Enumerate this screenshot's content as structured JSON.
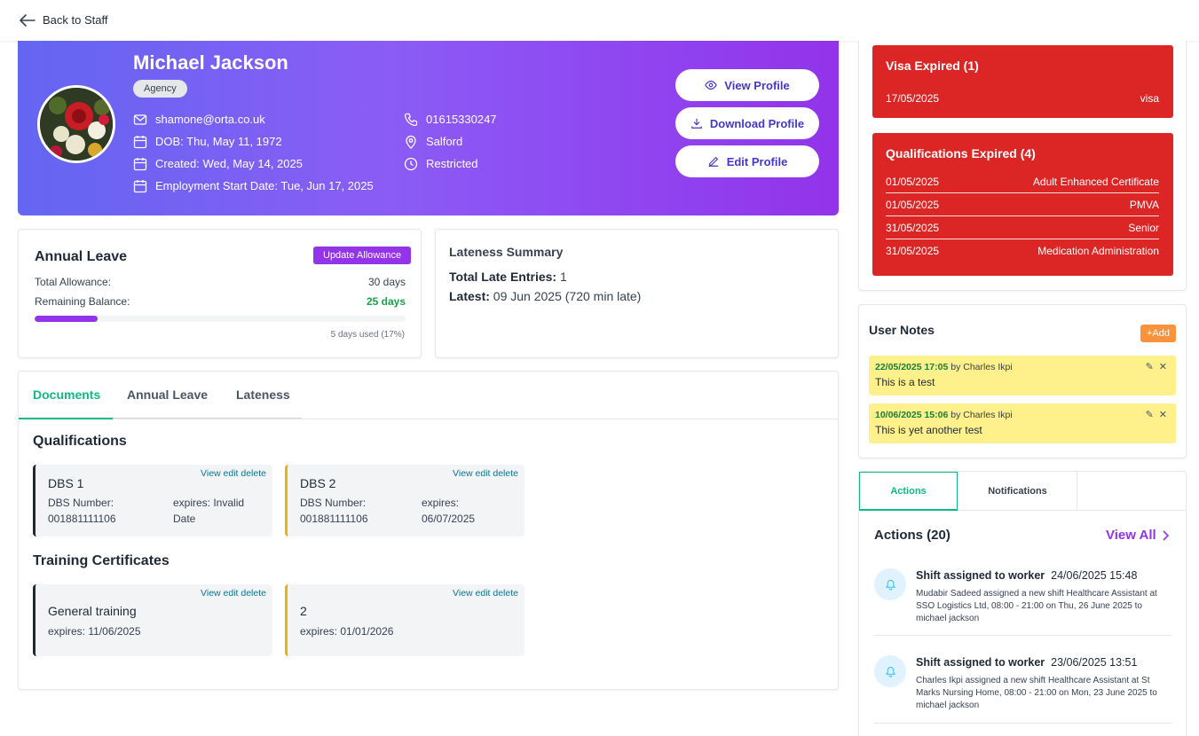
{
  "nav": {
    "back_label": "Back to Staff"
  },
  "profile": {
    "name": "Michael Jackson",
    "badge": "Agency",
    "email": "shamone@orta.co.uk",
    "dob": "DOB: Thu, May 11, 1972",
    "created": "Created: Wed, May 14, 2025",
    "employment_start": "Employment Start Date: Tue, Jun 17, 2025",
    "phone": "01615330247",
    "location": "Salford",
    "status": "Restricted",
    "buttons": {
      "view": "View Profile",
      "download": "Download Profile",
      "edit": "Edit Profile"
    }
  },
  "annual_leave": {
    "title": "Annual Leave",
    "update_button": "Update Allowance",
    "total_label": "Total Allowance:",
    "total_value": "30 days",
    "remaining_label": "Remaining Balance:",
    "remaining_value": "25 days",
    "used_fraction": 0.17,
    "used_note": "5 days used (17%)"
  },
  "lateness": {
    "title": "Lateness Summary",
    "entries_label": "Total Late Entries:",
    "entries_value": "1",
    "latest_label": "Latest:",
    "latest_value": "09 Jun 2025 (720 min late)"
  },
  "tabs": [
    "Documents",
    "Annual Leave",
    "Lateness"
  ],
  "documents": {
    "qualifications_title": "Qualifications",
    "training_title": "Training Certificates",
    "links_label": "View edit delete",
    "qualifications": [
      {
        "name": "DBS 1",
        "number_label": "DBS Number:",
        "number": "001881111106",
        "expires_label": "expires: Invalid",
        "expires_value": "Date"
      },
      {
        "name": "DBS 2",
        "number_label": "DBS Number:",
        "number": "001881111106",
        "expires_label": "expires:",
        "expires_value": "06/07/2025"
      }
    ],
    "training": [
      {
        "name": "General training",
        "expires": "expires: 11/06/2025"
      },
      {
        "name": "2",
        "expires": "expires: 01/01/2026"
      }
    ]
  },
  "alerts": {
    "visa": {
      "title": "Visa Expired (1)",
      "rows": [
        {
          "date": "17/05/2025",
          "item": "visa"
        }
      ]
    },
    "qualifications": {
      "title": "Qualifications Expired (4)",
      "rows": [
        {
          "date": "01/05/2025",
          "item": "Adult Enhanced Certificate"
        },
        {
          "date": "01/05/2025",
          "item": "PMVA"
        },
        {
          "date": "31/05/2025",
          "item": "Senior"
        },
        {
          "date": "31/05/2025",
          "item": "Medication Administration"
        }
      ]
    }
  },
  "notes": {
    "title": "User Notes",
    "add_label": "+Add",
    "items": [
      {
        "timestamp": "22/05/2025 17:05",
        "by": "by Charles Ikpi",
        "text": "This is a test"
      },
      {
        "timestamp": "10/06/2025 15:06",
        "by": "by Charles Ikpi",
        "text": "This is yet another test"
      }
    ]
  },
  "activity": {
    "tabs": [
      "Actions",
      "Notifications"
    ],
    "title": "Actions (20)",
    "view_all": "View All",
    "items": [
      {
        "title": "Shift assigned to worker",
        "time": "24/06/2025 15:48",
        "body": "Mudabir Sadeed assigned a new shift Healthcare Assistant at SSO Logistics Ltd, 08:00 - 21:00 on Thu, 26 June 2025 to michael jackson"
      },
      {
        "title": "Shift assigned to worker",
        "time": "23/06/2025 13:51",
        "body": "Charles Ikpi assigned a new shift Healthcare Assistant at St Marks Nursing Home, 08:00 - 21:00 on Mon, 23 June 2025 to michael jackson"
      }
    ]
  },
  "colors": {
    "hero_start": "#6366f1",
    "hero_end": "#9333ea",
    "accent_green": "#10b981",
    "alert_red": "#dc2626",
    "note_yellow": "#fef08a",
    "add_orange": "#fb923c"
  }
}
